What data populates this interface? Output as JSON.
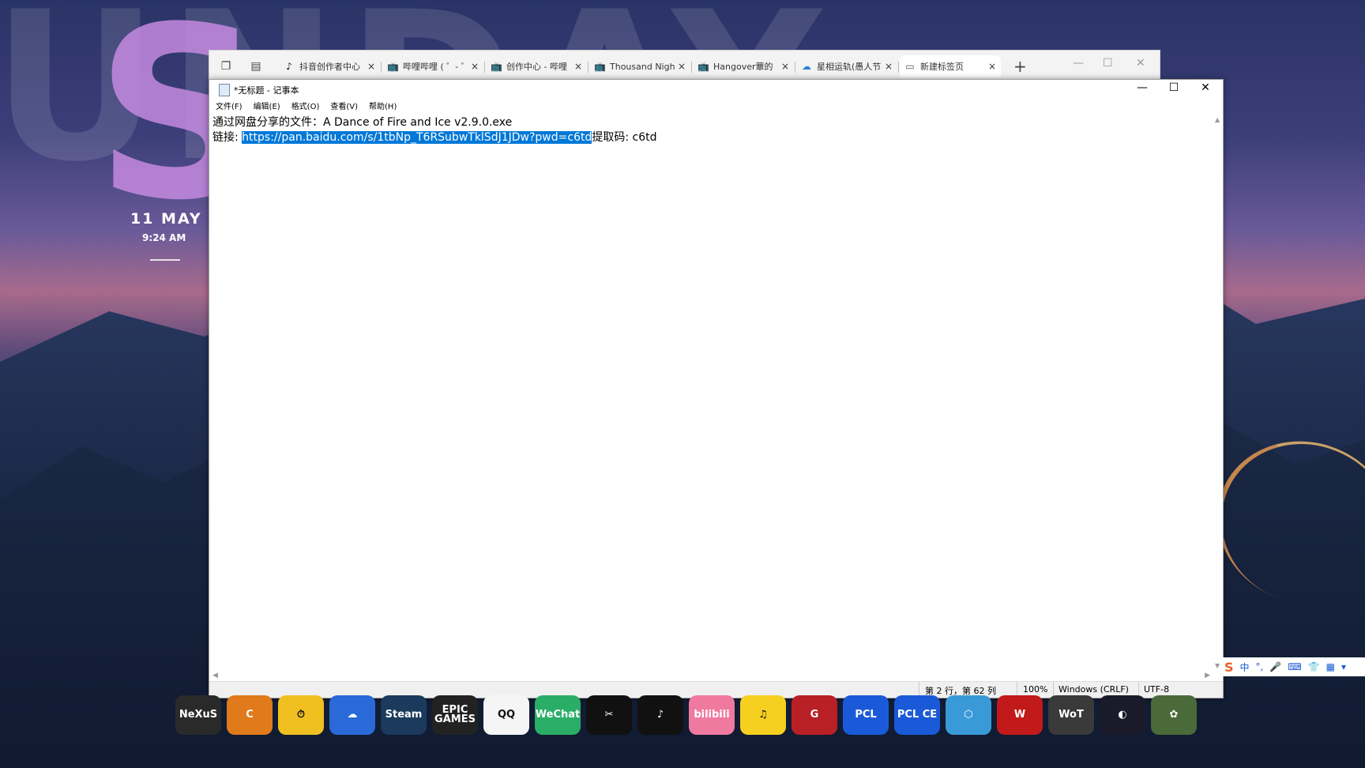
{
  "desktop": {
    "clock_date": "11 MAY",
    "clock_time": "9:24 AM",
    "bg_letters": "UNDAY",
    "bg_big_s": "S"
  },
  "browser": {
    "tabs": [
      {
        "label": "抖音创作者中心",
        "icon": "tiktok-icon"
      },
      {
        "label": "哔哩哔哩 ( ゜- ゜",
        "icon": "bilibili-tv-icon"
      },
      {
        "label": "创作中心 - 哔哩",
        "icon": "bilibili-tv-icon"
      },
      {
        "label": "Thousand Nigh",
        "icon": "bilibili-tv-icon"
      },
      {
        "label": "Hangover蕈的",
        "icon": "bilibili-tv-icon"
      },
      {
        "label": "星相运轨(愚人节",
        "icon": "cloud-icon"
      },
      {
        "label": "新建标签页",
        "icon": "page-icon"
      }
    ],
    "active_tab": 6,
    "new_tab": "+",
    "close": "×"
  },
  "notepad": {
    "title": "*无标题 - 记事本",
    "menu": [
      "文件(F)",
      "编辑(E)",
      "格式(O)",
      "查看(V)",
      "帮助(H)"
    ],
    "line1": "通过网盘分享的文件：A Dance of Fire and Ice v2.9.0.exe",
    "line2_prefix": "链接: ",
    "line2_selected": "https://pan.baidu.com/s/1tbNp_T6RSubwTklSdJ1JDw?pwd=c6td",
    "line2_suffix": "提取码: c6td",
    "status": {
      "position": "第 2 行，第 62 列",
      "zoom": "100%",
      "line_ending": "Windows (CRLF)",
      "encoding": "UTF-8"
    },
    "win_min": "—",
    "win_max": "☐",
    "win_close": "✕"
  },
  "ime": {
    "logo": "S",
    "lang": "中",
    "punct": "°,"
  },
  "dock": [
    {
      "label": "NeXuS",
      "name": "nexus-icon",
      "color": "#2a2a2a"
    },
    {
      "label": "C",
      "name": "orange-c-app-icon",
      "color": "#e07a1a"
    },
    {
      "label": "⏱",
      "name": "yellow-timer-app-icon",
      "color": "#f0c020"
    },
    {
      "label": "☁",
      "name": "cloud-gear-app-icon",
      "color": "#2a6ad8"
    },
    {
      "label": "Steam",
      "name": "steam-icon",
      "color": "#1b3a5c"
    },
    {
      "label": "EPIC GAMES",
      "name": "epic-games-icon",
      "color": "#222222"
    },
    {
      "label": "QQ",
      "name": "qq-icon",
      "color": "#f5f5f5"
    },
    {
      "label": "WeChat",
      "name": "wechat-icon",
      "color": "#2aae67"
    },
    {
      "label": "✂",
      "name": "capcut-icon",
      "color": "#111111"
    },
    {
      "label": "♪",
      "name": "tiktok-app-icon",
      "color": "#111111"
    },
    {
      "label": "bilibili",
      "name": "bilibili-app-icon",
      "color": "#f0799f"
    },
    {
      "label": "♫",
      "name": "qq-music-icon",
      "color": "#f5d020"
    },
    {
      "label": "G",
      "name": "netease-game-icon",
      "color": "#b82025"
    },
    {
      "label": "PCL",
      "name": "pcl-icon",
      "color": "#1a5ad8"
    },
    {
      "label": "PCL CE",
      "name": "pcl-ce-icon",
      "color": "#1a5ad8"
    },
    {
      "label": "⬡",
      "name": "network-app-icon",
      "color": "#3a9ad8"
    },
    {
      "label": "W",
      "name": "wargaming-icon",
      "color": "#c21a1a"
    },
    {
      "label": "WoT",
      "name": "world-of-tanks-icon",
      "color": "#3a3a3a"
    },
    {
      "label": "◐",
      "name": "red-blue-orb-icon",
      "color": "#1a1a2a"
    },
    {
      "label": "✿",
      "name": "flower-game-icon",
      "color": "#4a6a3a"
    }
  ]
}
